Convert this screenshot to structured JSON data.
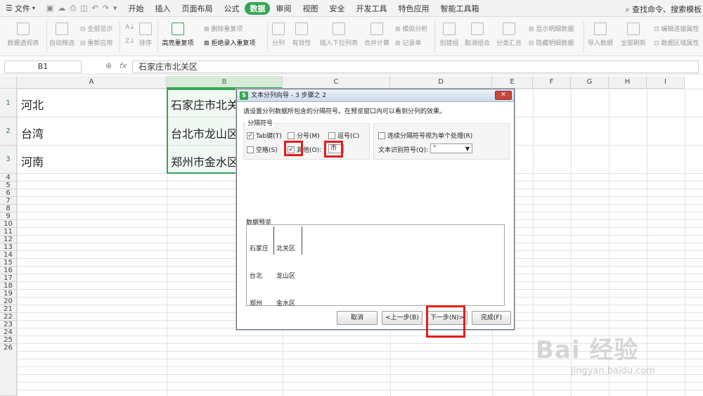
{
  "menu": {
    "file": "文件",
    "tabs": [
      "开始",
      "插入",
      "页面布局",
      "公式",
      "数据",
      "审阅",
      "视图",
      "安全",
      "开发工具",
      "特色应用",
      "智能工具箱"
    ],
    "active_tab": "数据",
    "search": "查找命令、搜索模板"
  },
  "ribbon": {
    "pivot": "数据透视表",
    "auto_filter": "自动筛选",
    "show_all": "全部显示",
    "reapply": "重新应用",
    "sort": "排序",
    "highlight_dup": "高亮重复项",
    "remove_dup": "删除重复项",
    "reject_dup": "拒绝录入重复项",
    "split": "分列",
    "validity": "有效性",
    "dropdown": "插入下拉列表",
    "consolidate": "合并计算",
    "simulate": "模拟分析",
    "record": "记录单",
    "create_group": "创建组",
    "ungroup": "取消组合",
    "subtotal": "分类汇总",
    "show_detail": "显示明细数据",
    "hide_detail": "隐藏明细数据",
    "import": "导入数据",
    "refresh_all": "全部刷新",
    "edit_links": "编辑连接属性",
    "data_area": "数据区域属性"
  },
  "formula_bar": {
    "name_box": "B1",
    "fx": "fx",
    "content": "石家庄市北关区"
  },
  "sheet": {
    "columns": [
      "A",
      "B",
      "C",
      "D",
      "E",
      "F",
      "G",
      "H",
      "I"
    ],
    "selected_column": "B",
    "rows": [
      "1",
      "2",
      "3",
      "4",
      "5",
      "6",
      "7",
      "8",
      "9",
      "10",
      "11",
      "12",
      "13",
      "14",
      "15",
      "16",
      "17",
      "18",
      "19",
      "20",
      "21",
      "22",
      "23",
      "24",
      "25",
      "26"
    ],
    "col_a": [
      "河北",
      "台湾",
      "河南"
    ],
    "col_b": [
      "石家庄市北关",
      "台北市龙山区",
      "郑州市金水区"
    ]
  },
  "dialog": {
    "title": "文本分列向导 - 3 步骤之 2",
    "instruction": "请设置分列数据所包含的分隔符号。在预览窗口内可以看到分列的效果。",
    "delimiters_label": "分隔符号",
    "tab_label": "Tab键(T)",
    "semicolon_label": "分号(M)",
    "comma_label": "逗号(C)",
    "space_label": "空格(S)",
    "other_label": "其他(O):",
    "other_value": "市",
    "consecutive_label": "连续分隔符号视为单个处理(R)",
    "qualifier_label": "文本识别符号(Q):",
    "qualifier_value": "\"",
    "preview_label": "数据预览",
    "preview_col1": [
      "石家庄",
      "台北",
      "郑州"
    ],
    "preview_col2": [
      "北关区",
      "龙山区",
      "金水区"
    ],
    "cancel": "取消",
    "back": "<上一步(B)",
    "next": "下一步(N)>",
    "finish": "完成(F)"
  },
  "watermark": {
    "main": "Bai 经验",
    "url": "jingyan.baidu.com"
  }
}
